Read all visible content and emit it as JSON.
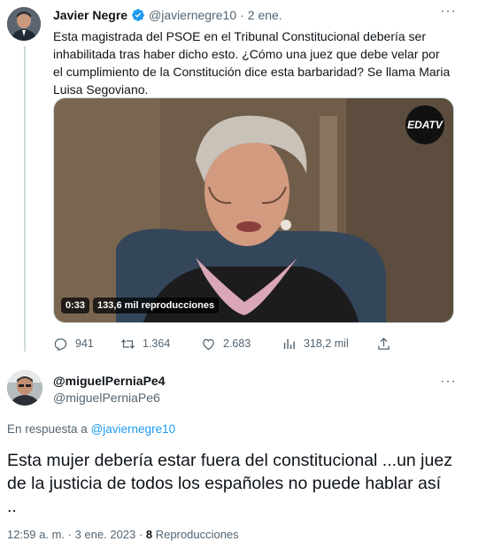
{
  "parent_tweet": {
    "author_name": "Javier Negre",
    "handle": "@javiernegre10",
    "separator": "·",
    "date": "2 ene.",
    "text": "Esta magistrada del PSOE en el Tribunal Constitucional debería ser inhabilitada tras haber dicho esto. ¿Cómo una juez que debe velar por el cumplimiento de la Constitución dice esta barbaridad? Se llama Maria Luisa Segoviano.",
    "media": {
      "channel_logo": "EDATV",
      "duration": "0:33",
      "views": "133,6 mil reproducciones"
    },
    "actions": {
      "replies": "941",
      "retweets": "1.364",
      "likes": "2.683",
      "views": "318,2 mil"
    },
    "icons": [
      "verified-badge-icon",
      "more-icon",
      "reply-icon",
      "retweet-icon",
      "like-icon",
      "views-icon",
      "share-icon"
    ]
  },
  "reply_tweet": {
    "author_name": "@miguelPerniaPe4",
    "handle": "@miguelPerniaPe6",
    "reply_to_label": "En respuesta a",
    "reply_to_mention": "@javiernegre10",
    "text": "Esta mujer debería estar fuera del constitucional ...un juez de la justicia de todos los españoles no puede hablar así ..",
    "timestamp": "12:59 a. m. · 3 ene. 2023 ·",
    "view_count": "8",
    "view_label": "Reproducciones"
  },
  "colors": {
    "accent": "#1d9bf0",
    "text_primary": "#0f1419",
    "text_secondary": "#536471",
    "border": "#cfd9de"
  }
}
